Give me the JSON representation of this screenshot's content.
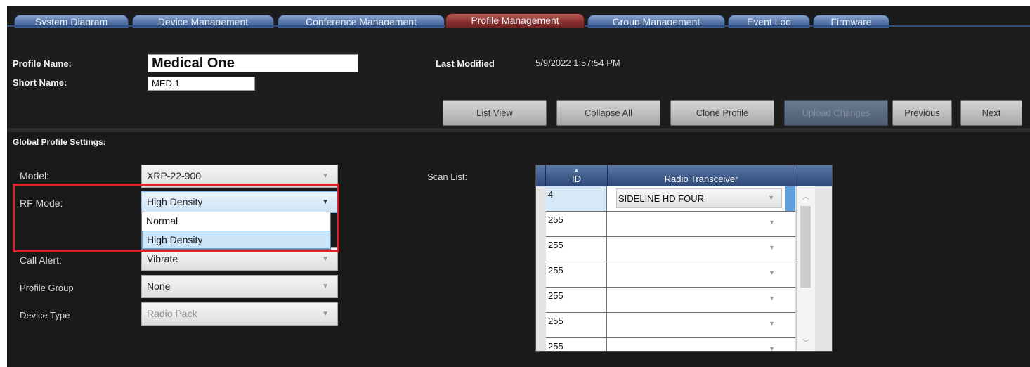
{
  "tabs": [
    {
      "label": "System Diagram",
      "active": false
    },
    {
      "label": "Device Management",
      "active": false
    },
    {
      "label": "Conference Management",
      "active": false
    },
    {
      "label": "Profile Management",
      "active": true
    },
    {
      "label": "Group Management",
      "active": false
    },
    {
      "label": "Event Log",
      "active": false
    },
    {
      "label": "Firmware",
      "active": false
    }
  ],
  "header": {
    "profile_name_label": "Profile Name:",
    "profile_name_value": "Medical One",
    "short_name_label": "Short Name:",
    "short_name_value": "MED 1",
    "last_modified_label": "Last Modified",
    "last_modified_value": "5/9/2022 1:57:54 PM"
  },
  "toolbar": {
    "list_view": "List View",
    "collapse_all": "Collapse All",
    "clone_profile": "Clone Profile",
    "upload_changes": "Upload Changes",
    "previous": "Previous",
    "next": "Next"
  },
  "global": {
    "section_title": "Global Profile Settings:",
    "model_label": "Model:",
    "model_value": "XRP-22-900",
    "rf_mode_label": "RF Mode:",
    "rf_mode_value": "High Density",
    "rf_mode_options": [
      "Normal",
      "High Density"
    ],
    "call_alert_label": "Call Alert:",
    "call_alert_value": "Vibrate",
    "profile_group_label": "Profile Group",
    "profile_group_value": "None",
    "device_type_label": "Device Type",
    "device_type_value": "Radio Pack"
  },
  "scan_list": {
    "label": "Scan List:",
    "columns": [
      "ID",
      "Radio Transceiver"
    ],
    "rows": [
      {
        "id": "4",
        "transceiver": "SIDELINE HD FOUR"
      },
      {
        "id": "255",
        "transceiver": ""
      },
      {
        "id": "255",
        "transceiver": ""
      },
      {
        "id": "255",
        "transceiver": ""
      },
      {
        "id": "255",
        "transceiver": ""
      },
      {
        "id": "255",
        "transceiver": ""
      },
      {
        "id": "255",
        "transceiver": ""
      }
    ]
  },
  "icons": {
    "dropdown_arrow": "chevron-down-icon",
    "sort_arrow": "sort-up-icon"
  },
  "colors": {
    "highlight_box": "#d8232a",
    "active_tab": "#8a302e",
    "tab": "#5b7bae",
    "grid_header": "#3b5a8c",
    "selection": "#5e9fe0"
  }
}
